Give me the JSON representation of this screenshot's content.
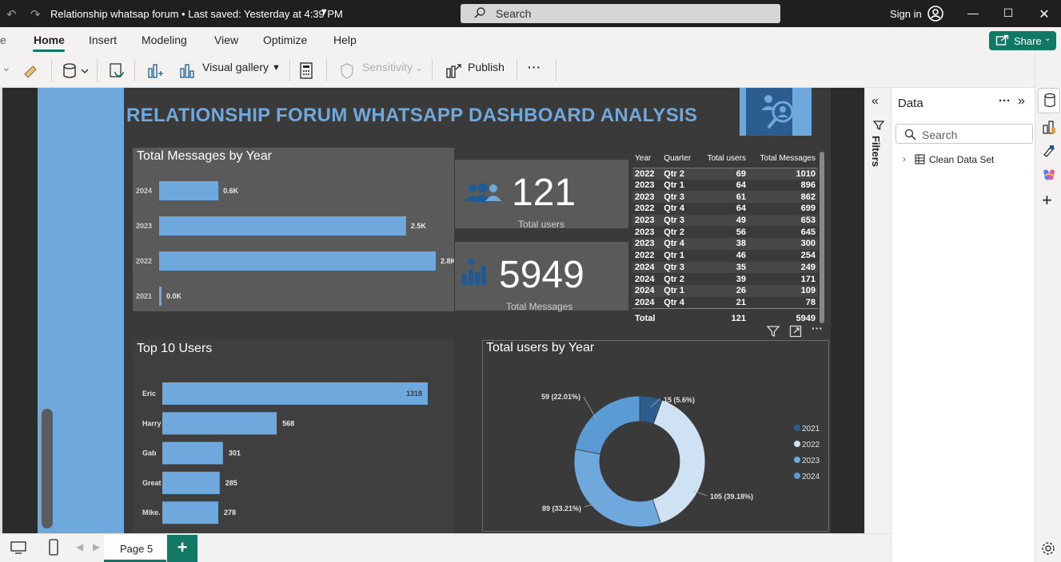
{
  "app": {
    "title": "Relationship whatsap forum • Last saved: Yesterday at 4:39 PM",
    "search_placeholder": "Search",
    "sign_in": "Sign in"
  },
  "menu": [
    "Home",
    "Insert",
    "Modeling",
    "View",
    "Optimize",
    "Help"
  ],
  "share_label": "Share",
  "toolbar": {
    "visual_gallery": "Visual gallery",
    "sensitivity": "Sensitivity",
    "publish": "Publish",
    "more": "···"
  },
  "dashboard": {
    "title": "RELATIONSHIP FORUM WHATSAPP DASHBOARD ANALYSIS",
    "kpi_users": {
      "value": "121",
      "label": "Total users"
    },
    "kpi_messages": {
      "value": "5949",
      "label": "Total Messages"
    }
  },
  "quarter_table": {
    "headers": [
      "Year",
      "Quarter",
      "Total users",
      "Total Messages"
    ],
    "rows": [
      [
        "2022",
        "Qtr 2",
        "69",
        "1010"
      ],
      [
        "2023",
        "Qtr 1",
        "64",
        "896"
      ],
      [
        "2023",
        "Qtr 3",
        "61",
        "862"
      ],
      [
        "2022",
        "Qtr 4",
        "64",
        "699"
      ],
      [
        "2023",
        "Qtr 3",
        "49",
        "653"
      ],
      [
        "2023",
        "Qtr 2",
        "56",
        "645"
      ],
      [
        "2023",
        "Qtr 4",
        "38",
        "300"
      ],
      [
        "2022",
        "Qtr 1",
        "46",
        "254"
      ],
      [
        "2024",
        "Qtr 3",
        "35",
        "249"
      ],
      [
        "2024",
        "Qtr 2",
        "39",
        "171"
      ],
      [
        "2024",
        "Qtr 1",
        "26",
        "109"
      ],
      [
        "2024",
        "Qtr 4",
        "21",
        "78"
      ]
    ],
    "total": [
      "Total",
      "121",
      "5949"
    ]
  },
  "chart_data": [
    {
      "type": "bar",
      "title": "Total Messages by Year",
      "categories": [
        "2024",
        "2023",
        "2022",
        "2021"
      ],
      "values": [
        0.6,
        2.5,
        2.8,
        0.0
      ],
      "labels": [
        "0.6K",
        "2.5K",
        "2.8K",
        "0.0K"
      ],
      "orientation": "horizontal",
      "color": "#6fa8dc"
    },
    {
      "type": "bar",
      "title": "Top 10 Users",
      "categories": [
        "Eric",
        "Harry",
        "Gab",
        "Great",
        "Mike."
      ],
      "values": [
        1318,
        568,
        301,
        285,
        278
      ],
      "orientation": "horizontal",
      "color": "#6fa8dc"
    },
    {
      "type": "pie",
      "title": "Total users by Year",
      "categories": [
        "2021",
        "2022",
        "2023",
        "2024"
      ],
      "values": [
        15,
        105,
        89,
        59
      ],
      "labels": [
        "15 (5.6%)",
        "105 (39.18%)",
        "89 (33.21%)",
        "59 (22.01%)"
      ],
      "colors": [
        "#2c5d8f",
        "#cfe2f3",
        "#6fa8dc",
        "#5b9bd5"
      ],
      "legend": [
        "2021",
        "2022",
        "2023",
        "2024"
      ],
      "legend_position": "right"
    }
  ],
  "right_pane": {
    "title": "Data",
    "search_placeholder": "Search",
    "dataset": "Clean Data Set",
    "filters_label": "Filters"
  },
  "bottom": {
    "page_tab": "Page 5",
    "add": "+"
  }
}
